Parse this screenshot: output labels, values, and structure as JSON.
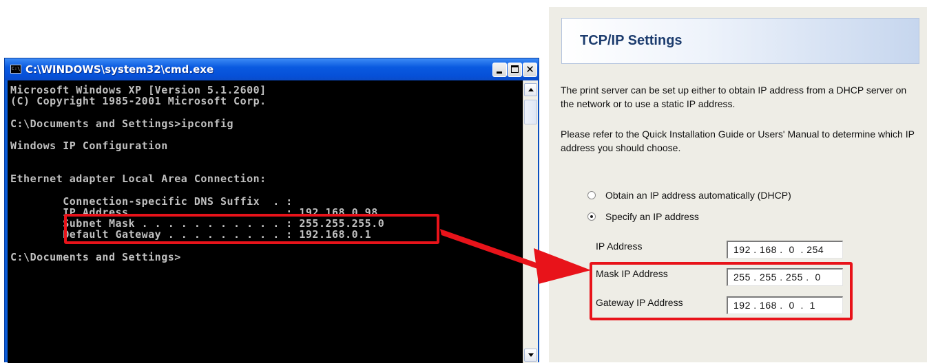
{
  "cmd": {
    "icon_text": "C:\\",
    "title": "C:\\WINDOWS\\system32\\cmd.exe",
    "lines": [
      "Microsoft Windows XP [Version 5.1.2600]",
      "(C) Copyright 1985-2001 Microsoft Corp.",
      "C:\\Documents and Settings>ipconfig",
      "Windows IP Configuration",
      "Ethernet adapter Local Area Connection:",
      "        Connection-specific DNS Suffix  . :",
      "        IP Address. . . . . . . . . . . . : 192.168.0.98",
      "        Subnet Mask . . . . . . . . . . . : 255.255.255.0",
      "        Default Gateway . . . . . . . . . : 192.168.0.1",
      "C:\\Documents and Settings>"
    ]
  },
  "tcp": {
    "title": "TCP/IP Settings",
    "para1": "The print server can be set up either to obtain IP address from a DHCP server on the network or to use a static IP address.",
    "para2": "Please refer to the Quick Installation Guide or Users' Manual to determine which IP address you should choose.",
    "radio_dhcp": "Obtain an IP address automatically (DHCP)",
    "radio_static": "Specify an IP address",
    "ip_label": "IP Address",
    "ip_value": "192 . 168 .  0  . 254",
    "mask_label": "Mask IP Address",
    "mask_value": "255 . 255 . 255 .  0",
    "gateway_label": "Gateway IP Address",
    "gateway_value": "192 . 168 .  0  .  1"
  },
  "colors": {
    "highlight": "#e8131a",
    "titlebar": "#0a5ae0",
    "console_bg": "#000000",
    "console_text": "#c0c0c0",
    "panel_bg": "#eeede6",
    "header_text": "#1c3c6e"
  }
}
